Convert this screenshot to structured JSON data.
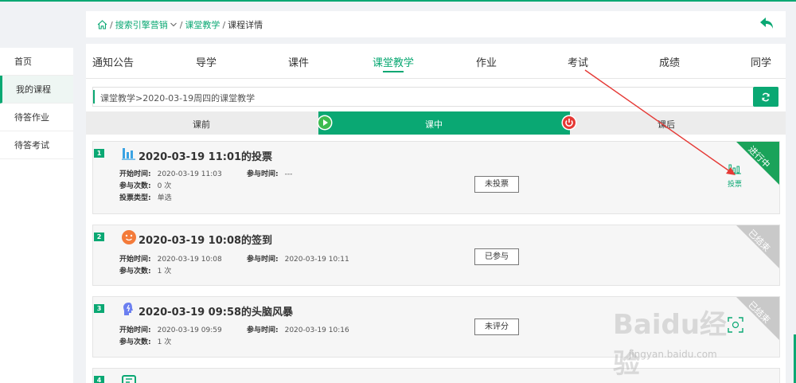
{
  "breadcrumb": {
    "items": [
      "搜索引擎营销",
      "课堂教学"
    ],
    "current": "课程详情"
  },
  "sidebar": {
    "items": [
      {
        "label": "首页"
      },
      {
        "label": "我的课程"
      },
      {
        "label": "待答作业"
      },
      {
        "label": "待答考试"
      }
    ]
  },
  "tabs": [
    {
      "label": "通知公告"
    },
    {
      "label": "导学"
    },
    {
      "label": "课件"
    },
    {
      "label": "课堂教学"
    },
    {
      "label": "作业"
    },
    {
      "label": "考试"
    },
    {
      "label": "成绩"
    },
    {
      "label": "同学"
    }
  ],
  "subpath": "课堂教学>2020-03-19周四的课堂教学",
  "phases": {
    "before": "课前",
    "during": "课中",
    "after": "课后"
  },
  "cards": [
    {
      "index": "1",
      "title": "2020-03-19 11:01的投票",
      "icon": "bar-chart-icon",
      "start_label": "开始时间:",
      "start": "2020-03-19 11:03",
      "join_label": "参与时间:",
      "join": "---",
      "count_label": "参与次数:",
      "count": "0 次",
      "type_label": "投票类型:",
      "type": "单选",
      "button": "未投票",
      "status": "进行中",
      "action": "投票"
    },
    {
      "index": "2",
      "title": "2020-03-19 10:08的签到",
      "icon": "smile-icon",
      "start_label": "开始时间:",
      "start": "2020-03-19 10:08",
      "join_label": "参与时间:",
      "join": "2020-03-19 10:11",
      "count_label": "参与次数:",
      "count": "1 次",
      "button": "已参与",
      "status": "已结束"
    },
    {
      "index": "3",
      "title": "2020-03-19 09:58的头脑风暴",
      "icon": "brain-icon",
      "start_label": "开始时间:",
      "start": "2020-03-19 09:59",
      "join_label": "参与时间:",
      "join": "2020-03-19 10:16",
      "count_label": "参与次数:",
      "count": "1 次",
      "button": "未评分",
      "status": "已结束"
    },
    {
      "index": "4"
    }
  ],
  "watermark": {
    "main": "Baidu经验",
    "sub": "jingyan.baidu.com"
  },
  "colors": {
    "accent": "#0aa873",
    "ribbon_active": "#1aa35a",
    "ribbon_ended": "#c9c9c9",
    "arrow": "#e53935"
  }
}
